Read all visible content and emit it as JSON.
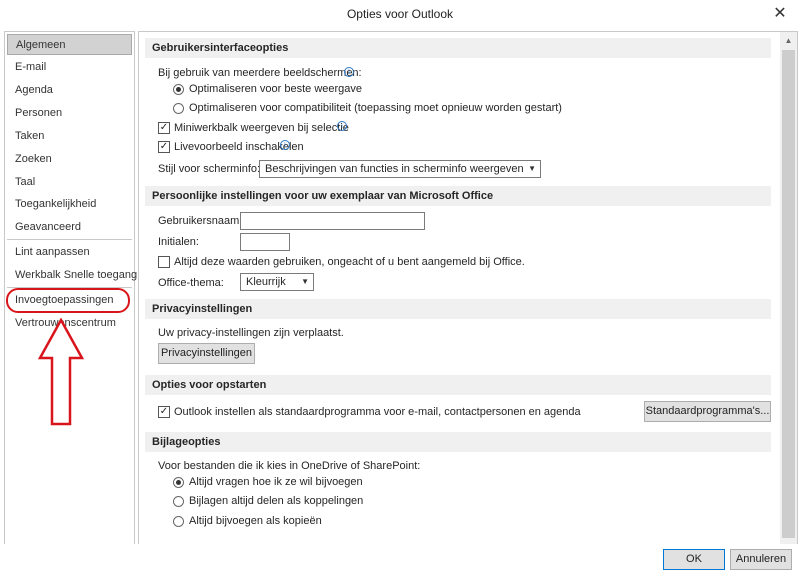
{
  "window": {
    "title": "Opties voor Outlook",
    "close_glyph": "✕"
  },
  "sidebar": {
    "items": [
      {
        "label": "Algemeen"
      },
      {
        "label": "E-mail"
      },
      {
        "label": "Agenda"
      },
      {
        "label": "Personen"
      },
      {
        "label": "Taken"
      },
      {
        "label": "Zoeken"
      },
      {
        "label": "Taal"
      },
      {
        "label": "Toegankelijkheid"
      },
      {
        "label": "Geavanceerd"
      },
      {
        "label": "Lint aanpassen"
      },
      {
        "label": "Werkbalk Snelle toegang"
      },
      {
        "label": "Invoegtoepassingen"
      },
      {
        "label": "Vertrouwenscentrum"
      }
    ],
    "selected": "Algemeen",
    "annotation_color": "#d9151c"
  },
  "ui_section": {
    "header": "Gebruikersinterfaceopties",
    "multi_screen_label": "Bij gebruik van meerdere beeldschermen:",
    "radio_best": "Optimaliseren voor beste weergave",
    "radio_compat": "Optimaliseren voor compatibiliteit (toepassing moet opnieuw worden gestart)",
    "mini_toolbar": "Miniwerkbalk weergeven bij selectie",
    "live_preview": "Livevoorbeeld inschakelen",
    "screentip_label": "Stijl voor scherminfo:",
    "screentip_value": "Beschrijvingen van functies in scherminfo weergeven"
  },
  "personal_section": {
    "header": "Persoonlijke instellingen voor uw exemplaar van Microsoft Office",
    "username_label": "Gebruikersnaam:",
    "username_value": "",
    "initials_label": "Initialen:",
    "initials_value": "",
    "always_use": "Altijd deze waarden gebruiken, ongeacht of u bent aangemeld bij Office.",
    "theme_label": "Office-thema:",
    "theme_value": "Kleurrijk"
  },
  "privacy_section": {
    "header": "Privacyinstellingen",
    "moved_text": "Uw privacy-instellingen zijn verplaatst.",
    "button": "Privacyinstellingen"
  },
  "startup_section": {
    "header": "Opties voor opstarten",
    "default_program": "Outlook instellen als standaardprogramma voor e-mail, contactpersonen en agenda",
    "button": "Standaardprogramma's..."
  },
  "attachment_section": {
    "header": "Bijlageopties",
    "intro": "Voor bestanden die ik kies in OneDrive of SharePoint:",
    "radio_ask": "Altijd vragen hoe ik ze wil bijvoegen",
    "radio_links": "Bijlagen altijd delen als koppelingen",
    "radio_copies": "Altijd bijvoegen als kopieën"
  },
  "footer": {
    "ok": "OK",
    "cancel": "Annuleren"
  },
  "glyphs": {
    "check": "✓",
    "caret": "▼",
    "info": "i",
    "scroll_up": "▲"
  }
}
